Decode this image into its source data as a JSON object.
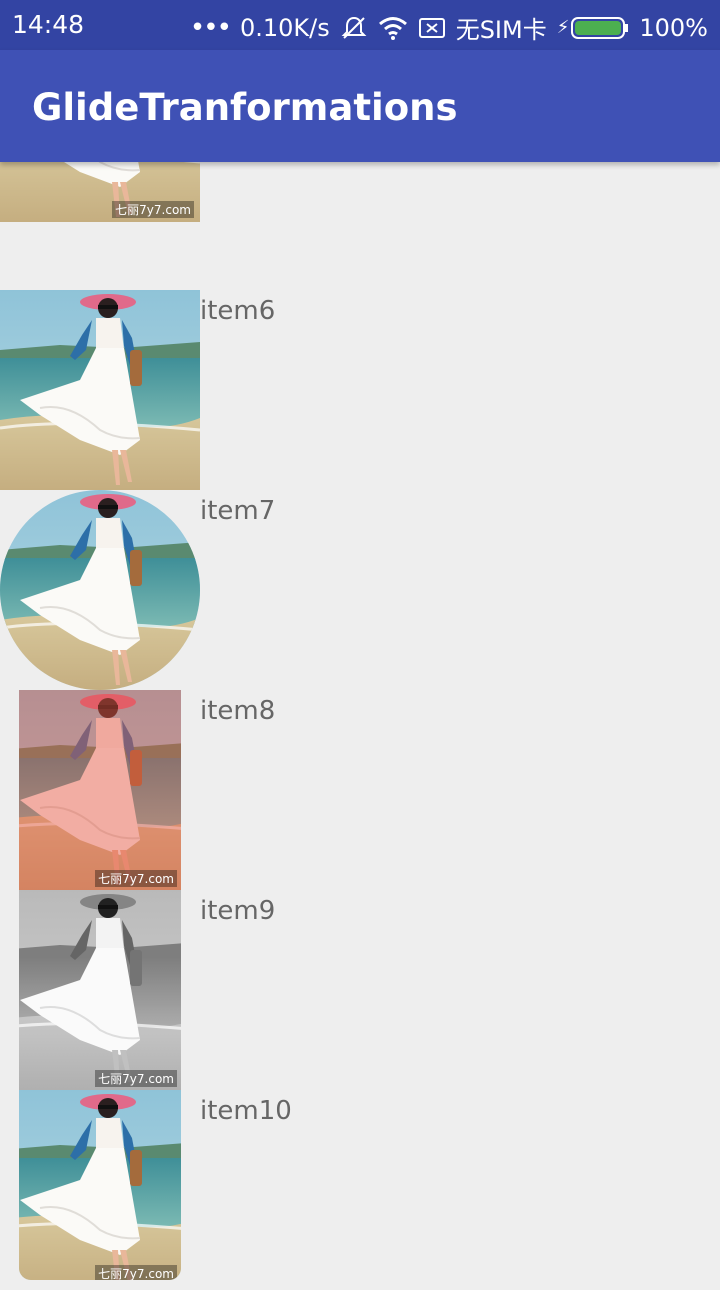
{
  "status_bar": {
    "time": "14:48",
    "speed": "0.10K/s",
    "sim": "无SIM卡",
    "battery": "100%"
  },
  "app_bar": {
    "title": "GlideTranformations"
  },
  "items": [
    {
      "label": "item6"
    },
    {
      "label": "item7"
    },
    {
      "label": "item8"
    },
    {
      "label": "item9"
    },
    {
      "label": "item10"
    }
  ],
  "watermark": "七丽7y7.com",
  "colors": {
    "status_bar": "#3344a3",
    "app_bar": "#3f51b5",
    "background": "#eeeeee",
    "battery_green": "#4caf50"
  }
}
